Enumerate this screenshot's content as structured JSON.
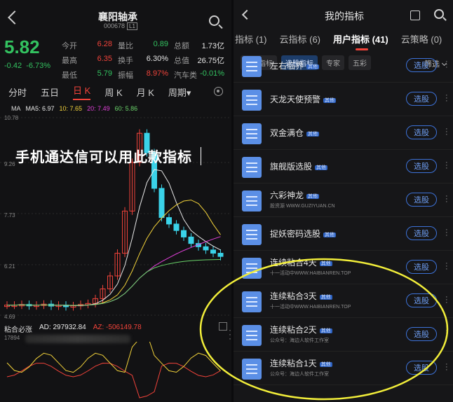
{
  "stock": {
    "name": "襄阳轴承",
    "code": "000678",
    "code_tag": "L1",
    "price": "5.82",
    "change": "-0.42",
    "change_pct": "-6.73%",
    "quote": [
      [
        {
          "k": "今开",
          "v": "6.28",
          "c": "red"
        },
        {
          "k": "量比",
          "v": "0.89",
          "c": "green"
        },
        {
          "k": "总额",
          "v": "1.73亿",
          "c": "white"
        }
      ],
      [
        {
          "k": "最高",
          "v": "6.35",
          "c": "red"
        },
        {
          "k": "换手",
          "v": "6.30%",
          "c": "white"
        },
        {
          "k": "总值",
          "v": "26.75亿",
          "c": "white"
        }
      ],
      [
        {
          "k": "最低",
          "v": "5.79",
          "c": "green"
        },
        {
          "k": "振幅",
          "v": "8.97%",
          "c": "red"
        },
        {
          "k": "汽车类",
          "v": "-0.01%",
          "c": "green"
        }
      ]
    ]
  },
  "periods": [
    "分时",
    "五日",
    "日 K",
    "周 K",
    "月 K",
    "周期▾"
  ],
  "active_period": "日 K",
  "ma": {
    "label": "MA",
    "ma5": "MA5: 6.97",
    "ma10": "10: 7.65",
    "ma20": "20: 7.49",
    "ma60": "60: 5.86"
  },
  "y_axis": [
    "10.78",
    "9.26",
    "7.73",
    "6.21",
    "4.69"
  ],
  "overlay_text": "手机通达信可以用此款指标",
  "sub_indicator": {
    "name": "粘合必涨",
    "ad": "AD: 297932.84",
    "az": "AZ: -506149.78",
    "y_top": "17894"
  },
  "right": {
    "title": "我的指标",
    "tabs": [
      "指标 (1)",
      "云指标 (6)",
      "用户指标 (41)",
      "云策略 (0)"
    ],
    "active_tab": "用户指标 (41)",
    "chips": [
      "技术指标",
      "选股指标",
      "专家",
      "五彩"
    ],
    "active_chip": "选股指标",
    "filter": "筛选",
    "button_label": "选股",
    "badge": "其他",
    "items": [
      {
        "name": "左右临界",
        "sub": ""
      },
      {
        "name": "天龙天使预警",
        "sub": ""
      },
      {
        "name": "双金满仓",
        "sub": ""
      },
      {
        "name": "旗舰版选股",
        "sub": ""
      },
      {
        "name": "六彩神龙",
        "sub": "股资源 WWW.GUZIYUAN.CN"
      },
      {
        "name": "捉妖密码选股",
        "sub": ""
      },
      {
        "name": "连续粘合4天",
        "sub": "十一活动中WWW.HAIBIANREN.TOP"
      },
      {
        "name": "连续粘合3天",
        "sub": "十一活动中WWW.HAIBIANREN.TOP"
      },
      {
        "name": "连续粘合2天",
        "sub": "公众号：海边人软件工作室"
      },
      {
        "name": "连续粘合1天",
        "sub": "公众号：海边人软件工作室"
      }
    ]
  },
  "colors": {
    "up": "#f0433a",
    "down": "#33c260",
    "accent": "#3d72d8",
    "highlight": "#f2ee3a"
  }
}
